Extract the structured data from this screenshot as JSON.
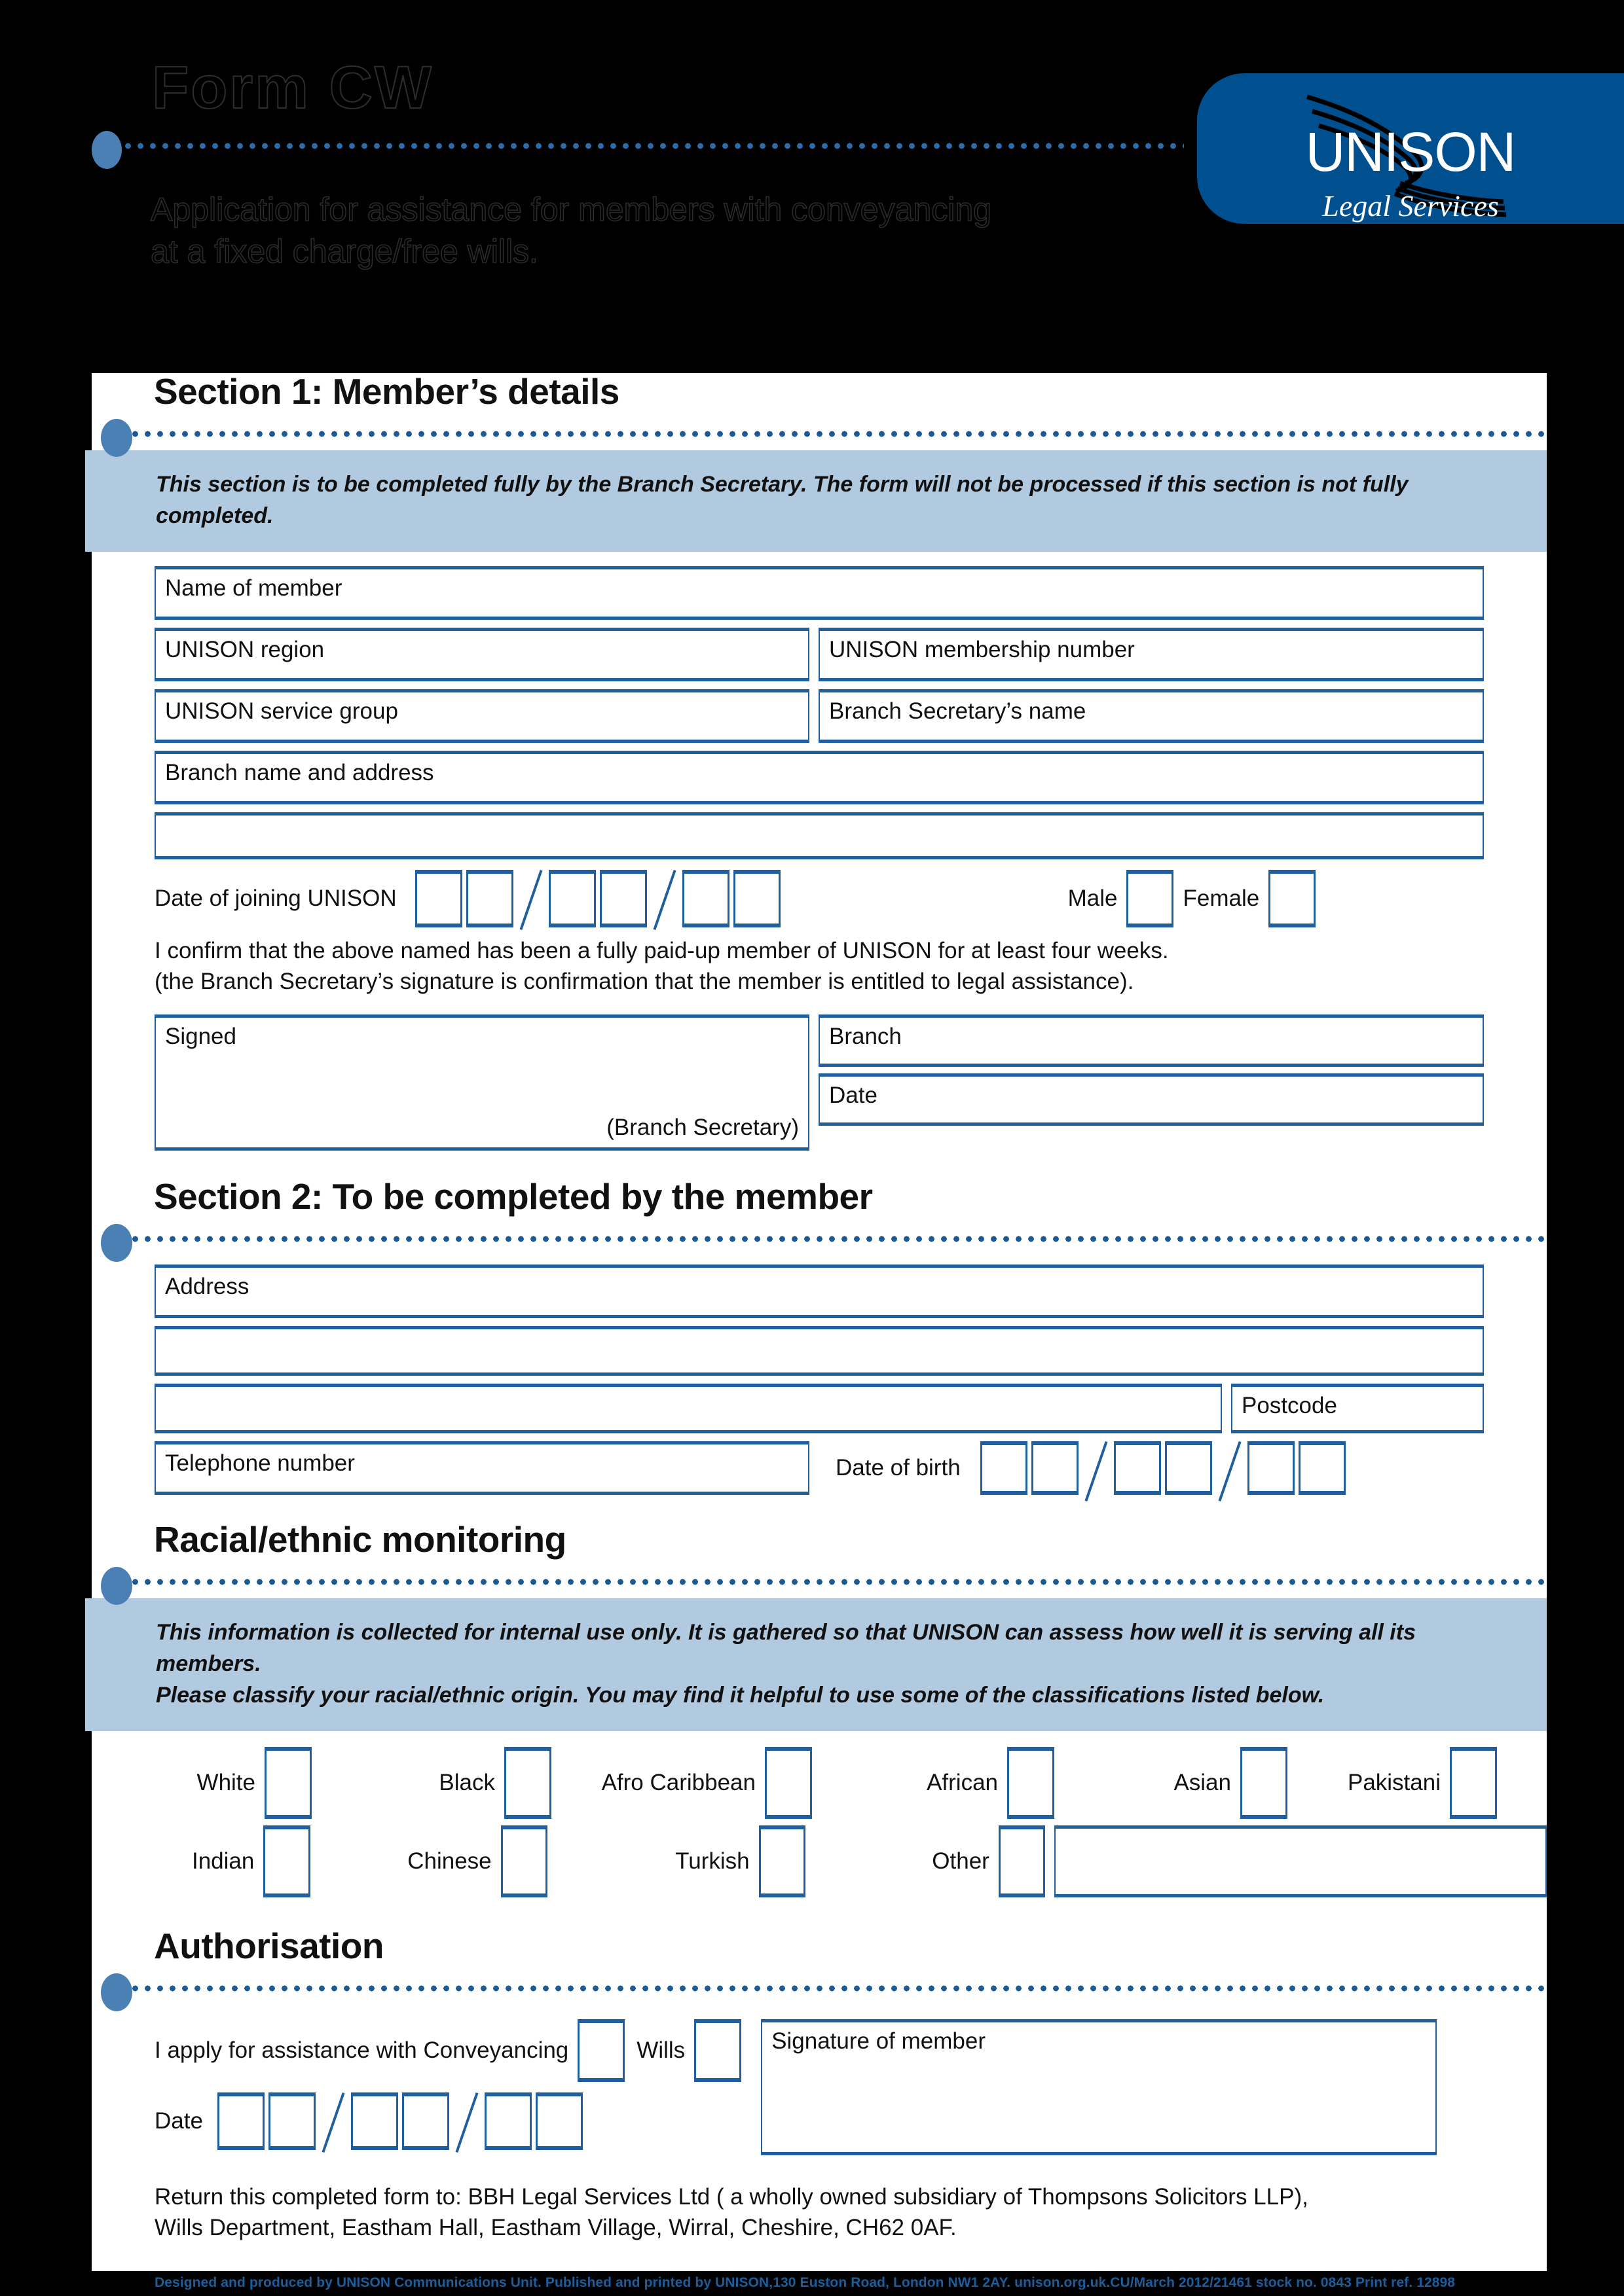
{
  "header": {
    "form_title": "Form CW",
    "subtitle_line1": "Application for assistance for members with conveyancing",
    "subtitle_line2": "at a fixed charge/free wills.",
    "logo_word": "UNISON",
    "logo_sub": "Legal Services",
    "brand_blue": "#00508f",
    "accent_blue": "#1f5f9e",
    "band_blue": "#b2cae0",
    "bullet_blue": "#4a80b4"
  },
  "section1": {
    "heading": "Section 1: Member’s details",
    "note": "This section is to be completed fully by the Branch Secretary. The form will not be processed if this section is not fully completed.",
    "f_name": "Name of member",
    "f_region": "UNISON region",
    "f_membership": "UNISON membership number",
    "f_service_group": "UNISON service group",
    "f_branch_sec_name": "Branch Secretary’s name",
    "f_branch_addr": "Branch name and address",
    "f_date_join": "Date of joining UNISON",
    "f_male": "Male",
    "f_female": "Female",
    "confirm_line1": "I confirm that the above named has been a fully paid-up member of UNISON for at least four weeks.",
    "confirm_line2": "(the Branch Secretary’s signature is confirmation that the member is entitled to legal assistance).",
    "f_signed": "Signed",
    "f_signed_note": "(Branch Secretary)",
    "f_branch": "Branch",
    "f_date": "Date"
  },
  "section2": {
    "heading": "Section 2: To be completed by the member",
    "f_address": "Address",
    "f_postcode": "Postcode",
    "f_telephone": "Telephone number",
    "f_dob": "Date of birth"
  },
  "ethnic": {
    "heading": "Racial/ethnic monitoring",
    "note_line1": "This information is collected for internal use only.  It is gathered so that UNISON can assess how well it is serving all its members.",
    "note_line2": "Please classify your racial/ethnic origin.  You may find it helpful to use some of the classifications listed below.",
    "row1": [
      "White",
      "Black",
      "Afro Caribbean",
      "African",
      "Asian",
      "Pakistani"
    ],
    "row2": [
      "Indian",
      "Chinese",
      "Turkish",
      "Other"
    ]
  },
  "authorisation": {
    "heading": "Authorisation",
    "apply_label": "I apply for assistance with Conveyancing",
    "wills_label": "Wills",
    "signature_label": "Signature of member",
    "date_label": "Date",
    "return_line1": "Return this completed form to: BBH Legal Services Ltd ( a wholly owned subsidiary of Thompsons Solicitors LLP),",
    "return_line2": "Wills Department, Eastham Hall, Eastham Village, Wirral, Cheshire, CH62 0AF."
  },
  "footer": {
    "credit": "Designed and produced by UNISON Communications Unit. Published and printed by UNISON,130 Euston Road, London NW1 2AY. unison.org.uk.CU/March 2012/21461 stock no. 0843 Print ref. 12898"
  }
}
